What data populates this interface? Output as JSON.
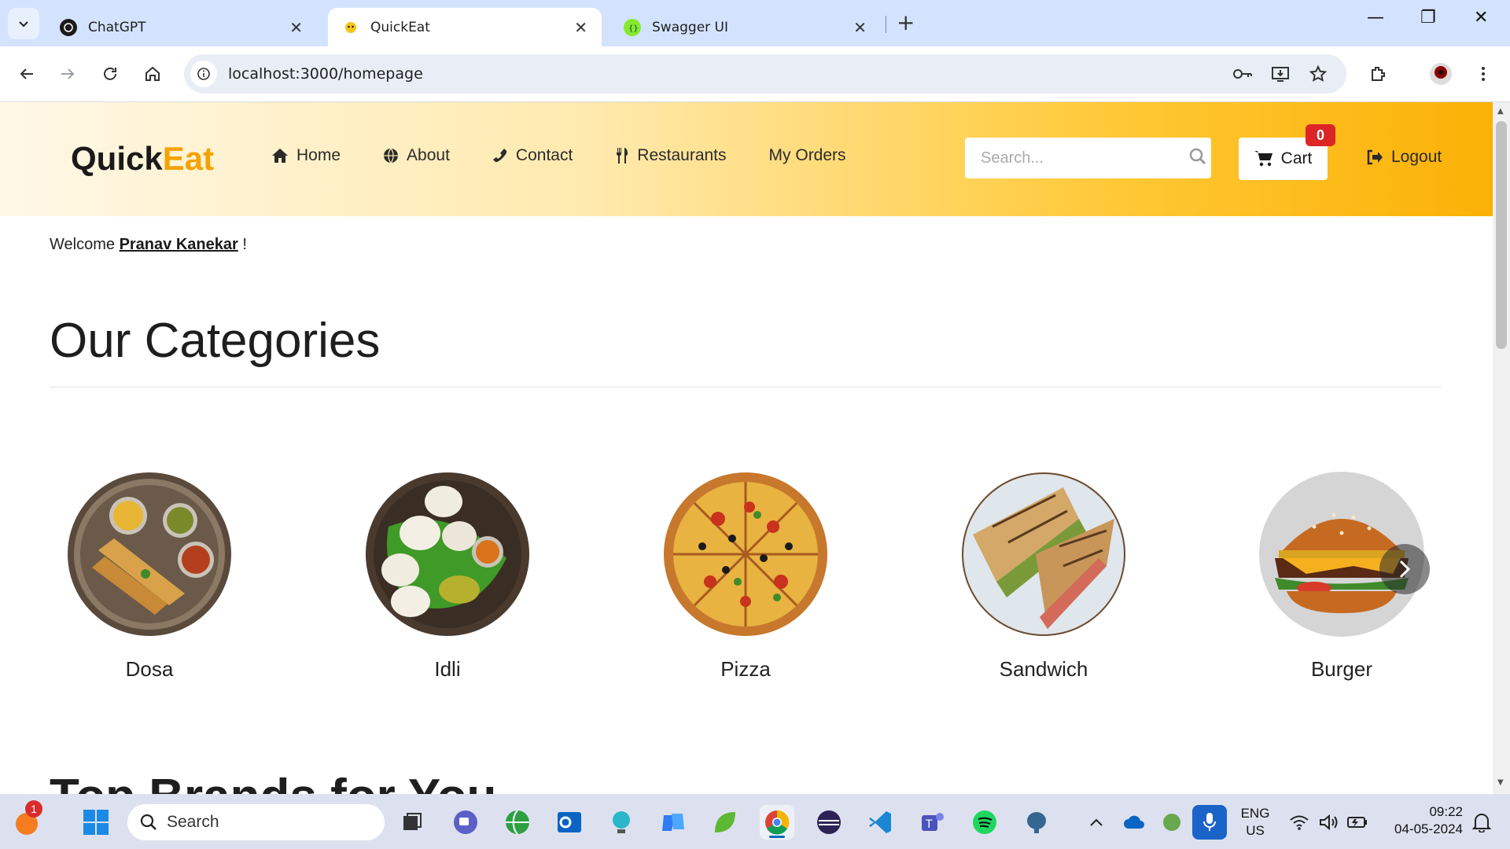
{
  "browser": {
    "tabs": [
      {
        "title": "ChatGPT",
        "icon": "chatgpt-icon",
        "active": false
      },
      {
        "title": "QuickEat",
        "icon": "quickeat-favicon",
        "active": true
      },
      {
        "title": "Swagger UI",
        "icon": "swagger-icon",
        "active": false
      }
    ],
    "url": "localhost:3000/homepage"
  },
  "navbar": {
    "brand_main": "Quick",
    "brand_accent": "Eat",
    "links": [
      {
        "label": "Home",
        "icon": "home-icon"
      },
      {
        "label": "About",
        "icon": "globe-icon"
      },
      {
        "label": "Contact",
        "icon": "phone-icon"
      },
      {
        "label": "Restaurants",
        "icon": "cutlery-icon"
      },
      {
        "label": "My Orders",
        "icon": ""
      }
    ],
    "search_placeholder": "Search...",
    "cart_label": "Cart",
    "cart_count": "0",
    "logout_label": "Logout"
  },
  "welcome": {
    "prefix": "Welcome",
    "user": "Pranav Kanekar",
    "suffix": "!"
  },
  "categories": {
    "heading": "Our Categories",
    "items": [
      {
        "name": "Dosa"
      },
      {
        "name": "Idli"
      },
      {
        "name": "Pizza"
      },
      {
        "name": "Sandwich"
      },
      {
        "name": "Burger"
      }
    ]
  },
  "next_section_heading": "Top Brands for You",
  "taskbar": {
    "search_placeholder": "Search",
    "notification_count": "1",
    "lang_line1": "ENG",
    "lang_line2": "US",
    "time": "09:22",
    "date": "04-05-2024"
  },
  "colors": {
    "accent": "#f5a200",
    "badge": "#dc2626"
  }
}
